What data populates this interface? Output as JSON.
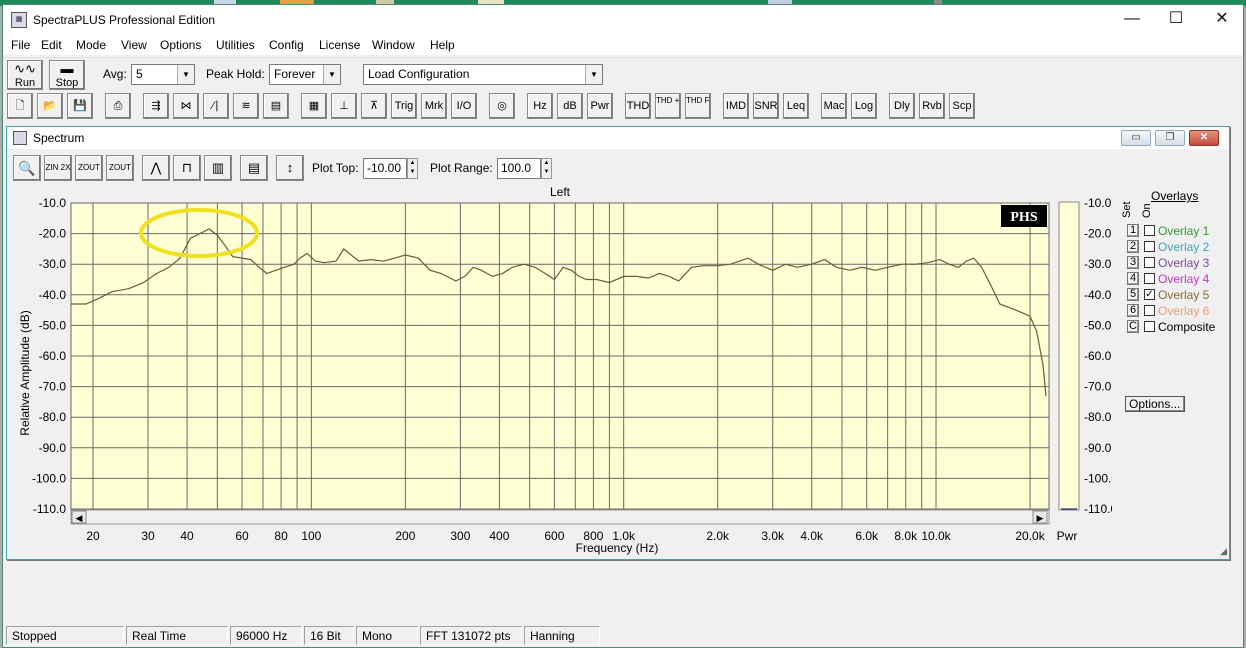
{
  "app": {
    "title": "SpectraPLUS Professional Edition"
  },
  "window_controls": {
    "minimize": "—",
    "maximize": "☐",
    "close": "✕"
  },
  "menu": [
    "File",
    "Edit",
    "Mode",
    "View",
    "Options",
    "Utilities",
    "Config",
    "License",
    "Window",
    "Help"
  ],
  "toolbar1": {
    "run_label": "Run",
    "stop_label": "Stop",
    "avg_label": "Avg:",
    "avg_value": "5",
    "peak_hold_label": "Peak Hold:",
    "peak_hold_value": "Forever",
    "config_value": "Load Configuration"
  },
  "toolbar2": {
    "buttons": [
      "Trig",
      "Mrk",
      "I/O",
      "Hz",
      "dB",
      "Pwr",
      "THD",
      "THD +N",
      "THD Freq",
      "IMD",
      "SNR",
      "Leq",
      "Mac",
      "Log",
      "Dly",
      "Rvb",
      "Scp"
    ]
  },
  "spectrum_window": {
    "title": "Spectrum",
    "zoom_buttons": [
      "ZIN 2X",
      "ZOUT 2X",
      "ZOUT FULL"
    ],
    "plot_top_label": "Plot Top:",
    "plot_top_value": "-10.00",
    "plot_range_label": "Plot Range:",
    "plot_range_value": "100.0",
    "channel_label": "Left",
    "logo": "PHS",
    "pwr_label": "Pwr"
  },
  "overlays": {
    "header": "Overlays",
    "set_label": "Set",
    "on_label": "On",
    "items": [
      {
        "num": "1",
        "name": "Overlay 1",
        "color": "#2e9a2e",
        "checked": false
      },
      {
        "num": "2",
        "name": "Overlay 2",
        "color": "#3aa8b8",
        "checked": false
      },
      {
        "num": "3",
        "name": "Overlay 3",
        "color": "#7a4aa0",
        "checked": false
      },
      {
        "num": "4",
        "name": "Overlay 4",
        "color": "#c832c8",
        "checked": false
      },
      {
        "num": "5",
        "name": "Overlay 5",
        "color": "#8a6a2a",
        "checked": true
      },
      {
        "num": "6",
        "name": "Overlay 6",
        "color": "#e8a070",
        "checked": false
      },
      {
        "num": "C",
        "name": "Composite",
        "color": "#000000",
        "checked": false
      }
    ],
    "options_label": "Options..."
  },
  "chart_data": {
    "type": "line",
    "title": "Left",
    "xlabel": "Frequency (Hz)",
    "ylabel": "Relative Amplitude (dB)",
    "x_scale": "log",
    "xlim": [
      17,
      23000
    ],
    "ylim": [
      -110,
      -10
    ],
    "y_ticks": [
      "-10.0",
      "-20.0",
      "-30.0",
      "-40.0",
      "-50.0",
      "-60.0",
      "-70.0",
      "-80.0",
      "-90.0",
      "-100.0",
      "-110.0"
    ],
    "x_tick_labels": [
      {
        "value": 20,
        "label": "20"
      },
      {
        "value": 30,
        "label": "30"
      },
      {
        "value": 40,
        "label": "40"
      },
      {
        "value": 60,
        "label": "60"
      },
      {
        "value": 80,
        "label": "80"
      },
      {
        "value": 100,
        "label": "100"
      },
      {
        "value": 200,
        "label": "200"
      },
      {
        "value": 300,
        "label": "300"
      },
      {
        "value": 400,
        "label": "400"
      },
      {
        "value": 600,
        "label": "600"
      },
      {
        "value": 800,
        "label": "800"
      },
      {
        "value": 1000,
        "label": "1.0k"
      },
      {
        "value": 2000,
        "label": "2.0k"
      },
      {
        "value": 3000,
        "label": "3.0k"
      },
      {
        "value": 4000,
        "label": "4.0k"
      },
      {
        "value": 6000,
        "label": "6.0k"
      },
      {
        "value": 8000,
        "label": "8.0k"
      },
      {
        "value": 10000,
        "label": "10.0k"
      },
      {
        "value": 20000,
        "label": "20.0k"
      }
    ],
    "grid": true,
    "plot_background": "#ffffd4",
    "line_color": "#6b5a3a",
    "highlight_ellipse_color": "#f0e020",
    "series": [
      {
        "points": [
          [
            17,
            -43
          ],
          [
            19,
            -43
          ],
          [
            21,
            -41
          ],
          [
            23,
            -39
          ],
          [
            26,
            -38
          ],
          [
            29,
            -36
          ],
          [
            32,
            -33
          ],
          [
            35,
            -31
          ],
          [
            38,
            -28
          ],
          [
            41,
            -21.5
          ],
          [
            43,
            -20.5
          ],
          [
            45,
            -19.5
          ],
          [
            47,
            -18.5
          ],
          [
            50,
            -20.5
          ],
          [
            53,
            -24
          ],
          [
            56,
            -27.5
          ],
          [
            60,
            -28
          ],
          [
            64,
            -28.5
          ],
          [
            68,
            -31
          ],
          [
            72,
            -33
          ],
          [
            77,
            -32
          ],
          [
            82,
            -31
          ],
          [
            88,
            -30
          ],
          [
            92,
            -28
          ],
          [
            97,
            -26.5
          ],
          [
            103,
            -29
          ],
          [
            110,
            -29.5
          ],
          [
            120,
            -29
          ],
          [
            127,
            -25
          ],
          [
            134,
            -27
          ],
          [
            142,
            -29
          ],
          [
            155,
            -28.5
          ],
          [
            170,
            -29
          ],
          [
            185,
            -28
          ],
          [
            200,
            -27
          ],
          [
            220,
            -28
          ],
          [
            240,
            -32
          ],
          [
            260,
            -33
          ],
          [
            290,
            -35.5
          ],
          [
            310,
            -34
          ],
          [
            330,
            -31
          ],
          [
            350,
            -32
          ],
          [
            380,
            -34
          ],
          [
            410,
            -33
          ],
          [
            440,
            -31
          ],
          [
            480,
            -30
          ],
          [
            520,
            -31
          ],
          [
            560,
            -33
          ],
          [
            600,
            -35
          ],
          [
            640,
            -31
          ],
          [
            680,
            -32
          ],
          [
            720,
            -34
          ],
          [
            760,
            -35
          ],
          [
            820,
            -35
          ],
          [
            900,
            -36
          ],
          [
            1000,
            -34
          ],
          [
            1100,
            -34
          ],
          [
            1200,
            -34.5
          ],
          [
            1300,
            -33
          ],
          [
            1400,
            -34
          ],
          [
            1500,
            -35.5
          ],
          [
            1650,
            -31
          ],
          [
            1800,
            -30.5
          ],
          [
            2000,
            -30.5
          ],
          [
            2200,
            -30
          ],
          [
            2500,
            -28
          ],
          [
            2700,
            -30
          ],
          [
            3000,
            -32
          ],
          [
            3300,
            -30
          ],
          [
            3600,
            -31
          ],
          [
            4000,
            -30
          ],
          [
            4400,
            -28.5
          ],
          [
            4800,
            -31
          ],
          [
            5300,
            -32
          ],
          [
            5800,
            -31
          ],
          [
            6400,
            -32
          ],
          [
            7000,
            -31
          ],
          [
            7800,
            -30
          ],
          [
            8600,
            -30
          ],
          [
            9400,
            -29.5
          ],
          [
            10300,
            -28.5
          ],
          [
            11000,
            -30
          ],
          [
            11800,
            -31
          ],
          [
            12500,
            -29
          ],
          [
            13200,
            -28
          ],
          [
            14000,
            -31
          ],
          [
            15000,
            -37
          ],
          [
            16000,
            -43
          ],
          [
            17000,
            -44
          ],
          [
            18000,
            -45
          ],
          [
            19000,
            -46
          ],
          [
            20000,
            -47
          ],
          [
            21000,
            -52
          ],
          [
            22000,
            -63
          ],
          [
            22500,
            -73
          ]
        ]
      }
    ]
  },
  "status": [
    "Stopped",
    "Real Time",
    "96000 Hz",
    "16 Bit",
    "Mono",
    "FFT 131072 pts",
    "Hanning"
  ]
}
